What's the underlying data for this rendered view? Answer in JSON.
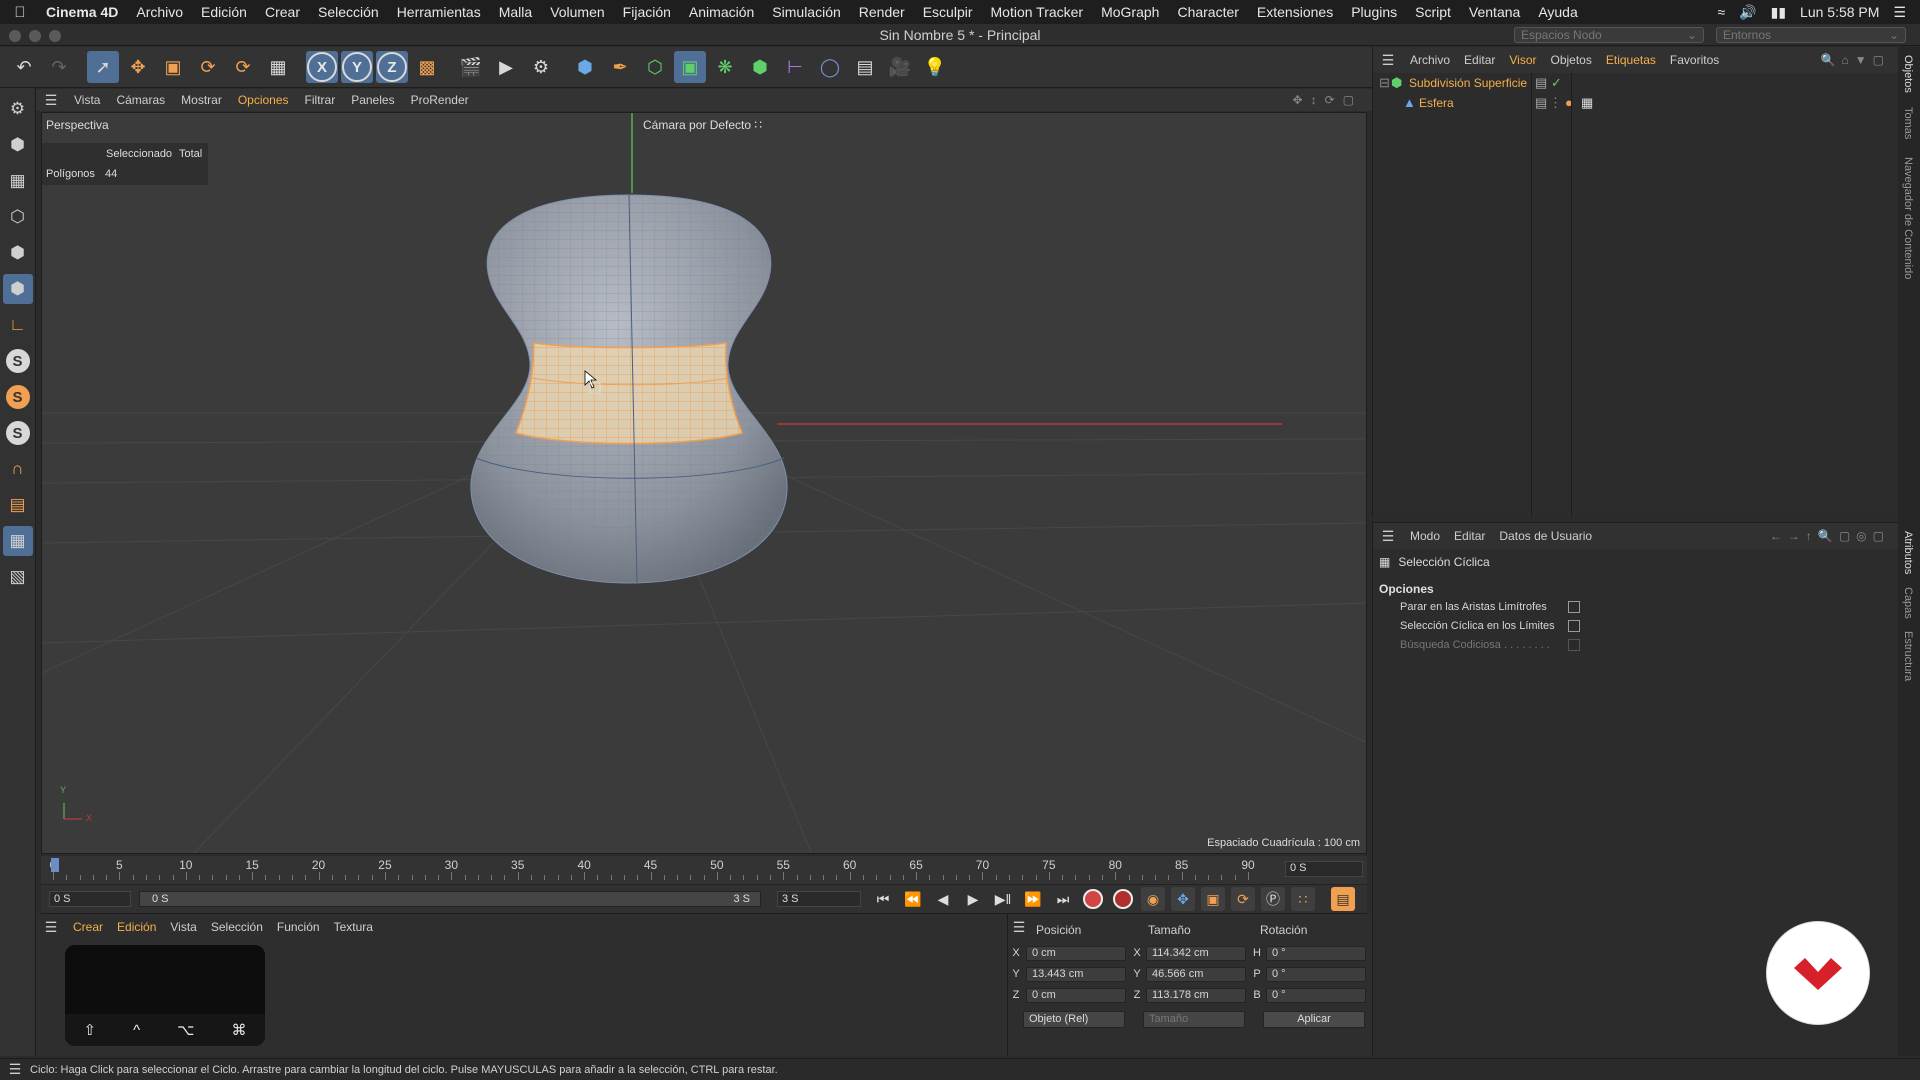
{
  "menubar": {
    "app": "Cinema 4D",
    "items": [
      "Archivo",
      "Edición",
      "Crear",
      "Selección",
      "Herramientas",
      "Malla",
      "Volumen",
      "Fijación",
      "Animación",
      "Simulación",
      "Render",
      "Esculpir",
      "Motion Tracker",
      "MoGraph",
      "Character",
      "Extensiones",
      "Plugins",
      "Script",
      "Ventana",
      "Ayuda"
    ],
    "clock": "Lun 5:58 PM",
    "node_spaces": "Espacios Nodo",
    "layouts": "Entornos"
  },
  "window": {
    "title": "Sin Nombre 5 * - Principal"
  },
  "viewport": {
    "menu": [
      "Vista",
      "Cámaras",
      "Mostrar",
      "Opciones",
      "Filtrar",
      "Paneles",
      "ProRender"
    ],
    "active_menu": "Opciones",
    "label": "Perspectiva",
    "camera": "Cámara por Defecto",
    "hud": {
      "col_selected": "Seleccionado",
      "col_total": "Total",
      "row_label": "Polígonos",
      "row_value": "44"
    },
    "grid_spacing": "Espaciado Cuadrícula : 100 cm",
    "axis_y": "Y",
    "axis_x": "X"
  },
  "timeline": {
    "labels": [
      "0",
      "5",
      "10",
      "15",
      "20",
      "25",
      "30",
      "35",
      "40",
      "45",
      "50",
      "55",
      "60",
      "65",
      "70",
      "75",
      "80",
      "85",
      "90"
    ],
    "current_frame": "0 S"
  },
  "playback": {
    "start": "0 S",
    "range_start": "0 S",
    "range_end": "3 S",
    "end": "3 S"
  },
  "material_manager": {
    "menu": [
      "Crear",
      "Edición",
      "Vista",
      "Selección",
      "Función",
      "Textura"
    ],
    "highlighted": [
      "Crear",
      "Edición"
    ],
    "keys": [
      "⇧",
      "^",
      "⌥",
      "⌘"
    ]
  },
  "coordinates": {
    "headers": {
      "position": "Posición",
      "size": "Tamaño",
      "rotation": "Rotación"
    },
    "rows": [
      {
        "axis": "X",
        "pos": "0 cm",
        "saxis": "X",
        "size": "114.342 cm",
        "raxis": "H",
        "rot": "0 °"
      },
      {
        "axis": "Y",
        "pos": "13.443 cm",
        "saxis": "Y",
        "size": "46.566 cm",
        "raxis": "P",
        "rot": "0 °"
      },
      {
        "axis": "Z",
        "pos": "0 cm",
        "saxis": "Z",
        "size": "113.178 cm",
        "raxis": "B",
        "rot": "0 °"
      }
    ],
    "mode": "Objeto (Rel)",
    "size_mode": "Tamaño",
    "apply": "Aplicar"
  },
  "object_manager": {
    "menu": [
      "Archivo",
      "Editar",
      "Visor",
      "Objetos",
      "Etiquetas",
      "Favoritos"
    ],
    "highlighted": [
      "Visor",
      "Etiquetas"
    ],
    "objects": [
      {
        "name": "Subdivisión Superficie"
      },
      {
        "name": "Esfera"
      }
    ]
  },
  "attribute_manager": {
    "menu": [
      "Modo",
      "Editar",
      "Datos de Usuario"
    ],
    "title": "Selección Cíclica",
    "section": "Opciones",
    "options": [
      {
        "label": "Parar en las Aristas Limítrofes",
        "enabled": true
      },
      {
        "label": "Selección Cíclica en los Límites",
        "enabled": true
      },
      {
        "label": "Búsqueda Codiciosa . . . . . . . .",
        "enabled": false
      }
    ]
  },
  "side_tabs": [
    "Objetos",
    "Tomas",
    "Navegador de Contenido",
    "Atributos",
    "Capas",
    "Estructura"
  ],
  "status": "Ciclo: Haga Click para seleccionar el Ciclo. Arrastre para cambiar la longitud del ciclo. Pulse MAYUSCULAS para añadir a la selección, CTRL para restar.",
  "colors": {
    "accent": "#f5b04a",
    "active_tool": "#4f6f96",
    "selection": "#f0a050",
    "logo_red": "#d6202a"
  }
}
